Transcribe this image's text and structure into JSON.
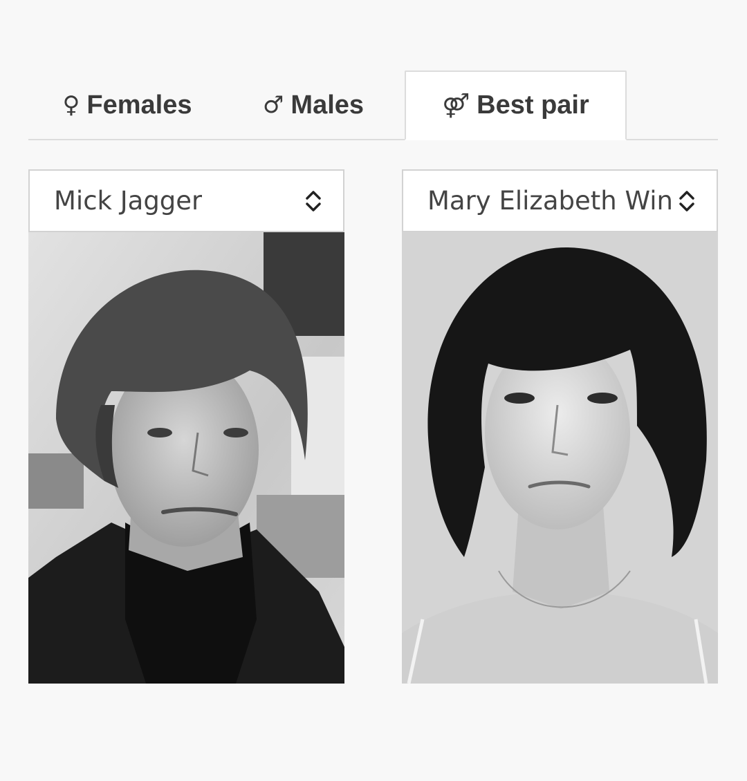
{
  "tabs": [
    {
      "glyph": "♀",
      "label": "Females",
      "icon": "female-icon"
    },
    {
      "glyph": "♂",
      "label": "Males",
      "icon": "male-icon"
    },
    {
      "glyph": "⚤",
      "label": "Best pair",
      "icon": "pair-icon",
      "active": true
    }
  ],
  "left": {
    "selected": "Mick Jagger",
    "photo": "person-photo-male"
  },
  "right": {
    "selected": "Mary Elizabeth Win:",
    "photo": "person-photo-female"
  },
  "colors": {
    "background": "#f8f8f8",
    "tab_text": "#3a3a3a",
    "border": "#dcdcdc"
  }
}
